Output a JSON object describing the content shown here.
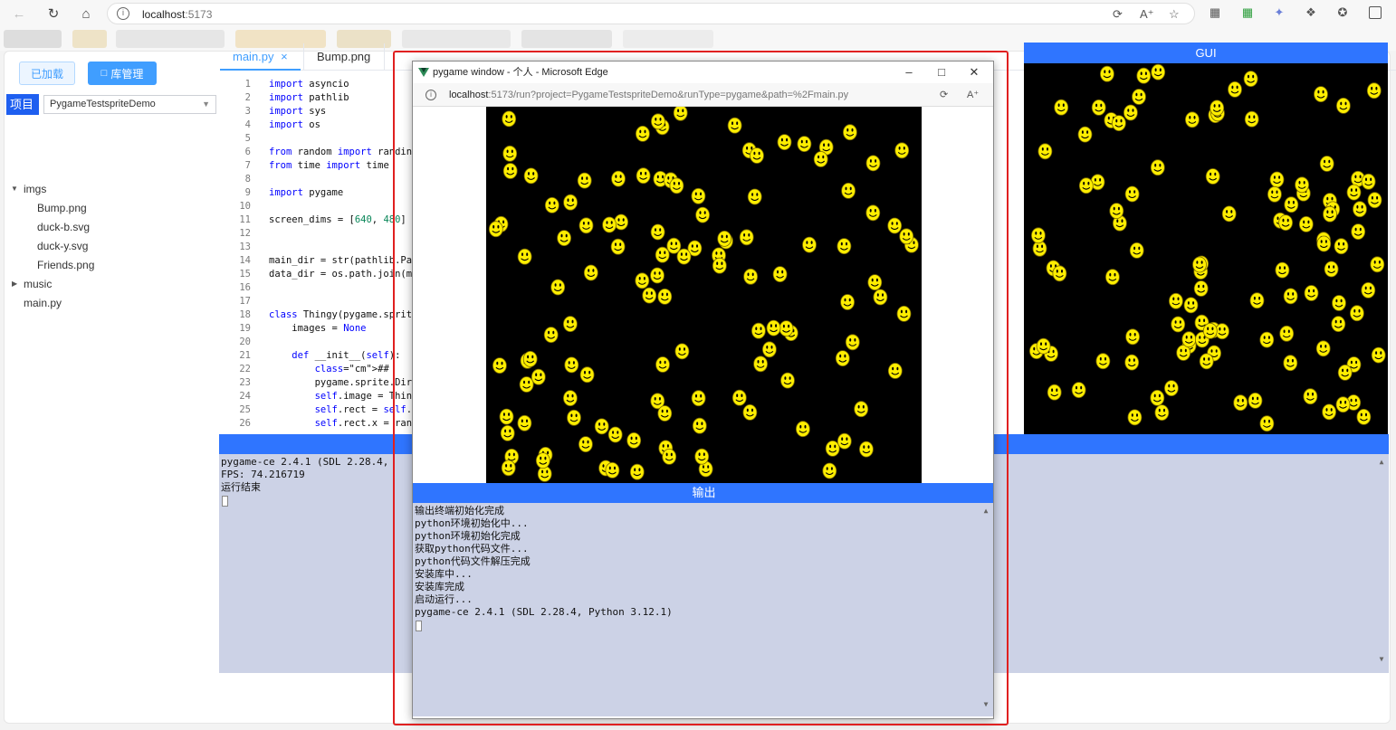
{
  "browser": {
    "url_host": "localhost",
    "url_port": ":5173"
  },
  "app": {
    "buttons": {
      "loaded": "已加载",
      "library": "库管理"
    },
    "project_label": "项目",
    "project_select": "PygameTestspriteDemo",
    "tree": [
      {
        "label": "imgs",
        "type": "folder",
        "expanded": true
      },
      {
        "label": "Bump.png",
        "type": "file"
      },
      {
        "label": "duck-b.svg",
        "type": "file"
      },
      {
        "label": "duck-y.svg",
        "type": "file"
      },
      {
        "label": "Friends.png",
        "type": "file"
      },
      {
        "label": "music",
        "type": "folder",
        "expanded": false
      },
      {
        "label": "main.py",
        "type": "file"
      }
    ],
    "tabs": [
      {
        "label": "main.py",
        "closable": "×"
      },
      {
        "label": "Bump.png"
      }
    ],
    "gui_title": "GUI",
    "output_title": "输出",
    "output_lines": [
      "pygame-ce 2.4.1 (SDL 2.28.4,",
      "FPS: 74.216719",
      "运行结束"
    ]
  },
  "code": [
    {
      "n": "1",
      "t": "import asyncio"
    },
    {
      "n": "2",
      "t": "import pathlib"
    },
    {
      "n": "3",
      "t": "import sys"
    },
    {
      "n": "4",
      "t": "import os"
    },
    {
      "n": "5",
      "t": ""
    },
    {
      "n": "6",
      "t": "from random import randint"
    },
    {
      "n": "7",
      "t": "from time import time"
    },
    {
      "n": "8",
      "t": ""
    },
    {
      "n": "9",
      "t": "import pygame"
    },
    {
      "n": "10",
      "t": ""
    },
    {
      "n": "11",
      "t": "screen_dims = [640, 480]"
    },
    {
      "n": "12",
      "t": ""
    },
    {
      "n": "13",
      "t": ""
    },
    {
      "n": "14",
      "t": "main_dir = str(pathlib.Pat"
    },
    {
      "n": "15",
      "t": "data_dir = os.path.join(ma"
    },
    {
      "n": "16",
      "t": ""
    },
    {
      "n": "17",
      "t": ""
    },
    {
      "n": "18",
      "t": "class Thingy(pygame.sprite"
    },
    {
      "n": "19",
      "t": "    images = None"
    },
    {
      "n": "20",
      "t": ""
    },
    {
      "n": "21",
      "t": "    def __init__(self):"
    },
    {
      "n": "22",
      "t": "        ##        pygame.s"
    },
    {
      "n": "23",
      "t": "        pygame.sprite.Dirt"
    },
    {
      "n": "24",
      "t": "        self.image = Thing"
    },
    {
      "n": "25",
      "t": "        self.rect = self.i"
    },
    {
      "n": "26",
      "t": "        self.rect.x = rand"
    }
  ],
  "popup": {
    "title": "pygame window - 个人 - Microsoft Edge",
    "url_host": "localhost",
    "url_rest": ":5173/run?project=PygameTestspriteDemo&runType=pygame&path=%2Fmain.py",
    "output_title": "输出",
    "output_lines": [
      "输出终端初始化完成",
      "python环境初始化中...",
      "python环境初始化完成",
      "获取python代码文件...",
      "python代码文件解压完成",
      "安装库中...",
      "安装库完成",
      "启动运行...",
      "pygame-ce 2.4.1 (SDL 2.28.4, Python 3.12.1)"
    ]
  },
  "colors": {
    "accent": "#409eff",
    "panel_header": "#2f75ff",
    "output_bg": "#ccd2e6",
    "highlight_box": "#e02020",
    "sprite": "#ffee00"
  }
}
